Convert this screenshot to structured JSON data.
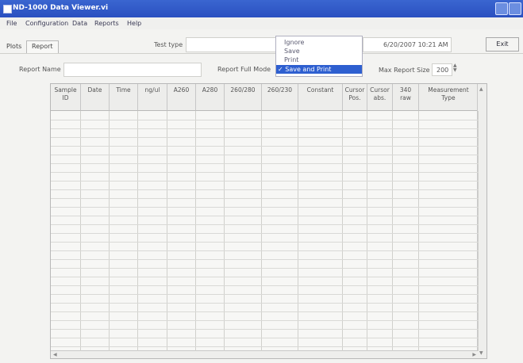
{
  "window": {
    "title": "ND-1000 Data Viewer.vi"
  },
  "menu": [
    "File",
    "Configuration",
    "Data",
    "Reports",
    "Help"
  ],
  "tabs": [
    {
      "label": "Plots"
    },
    {
      "label": "Report"
    }
  ],
  "test_type_label": "Test type",
  "report_mode_dropdown": {
    "options": [
      "Ignore",
      "Save",
      "Print",
      "Save and Print"
    ],
    "selected": "Save and Print",
    "check": "✓"
  },
  "datetime": "6/20/2007 10:21 AM",
  "exit_label": "Exit",
  "report_name_label": "Report Name",
  "report_full_mode_label": "Report Full Mode",
  "max_report_size": {
    "label": "Max Report Size",
    "value": "200"
  },
  "table": {
    "columns": [
      "Sample\nID",
      "Date",
      "Time",
      "ng/ul",
      "A260",
      "A280",
      "260/280",
      "260/230",
      "Constant",
      "Cursor\nPos.",
      "Cursor\nabs.",
      "340\nraw",
      "Measurement\nType"
    ],
    "rows": []
  },
  "icons": {
    "window": "app-window-icon",
    "spinner": "updown-spinner-icon"
  },
  "colors": {
    "titlebar": "#2a50c0",
    "selection": "#2e5fd0"
  }
}
